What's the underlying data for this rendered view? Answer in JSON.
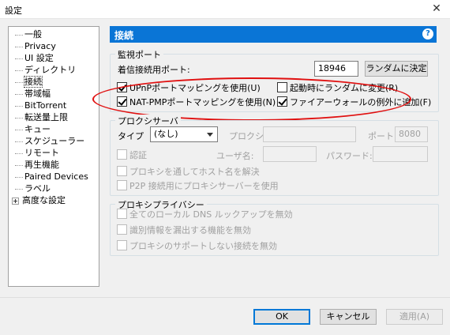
{
  "window": {
    "title": "設定",
    "close_glyph": "✕"
  },
  "tree": {
    "items": [
      {
        "label": "一般"
      },
      {
        "label": "Privacy"
      },
      {
        "label": "UI 設定"
      },
      {
        "label": "ディレクトリ"
      },
      {
        "label": "接続"
      },
      {
        "label": "帯域幅"
      },
      {
        "label": "BitTorrent"
      },
      {
        "label": "転送量上限"
      },
      {
        "label": "キュー"
      },
      {
        "label": "スケジューラー"
      },
      {
        "label": "リモート"
      },
      {
        "label": "再生機能"
      },
      {
        "label": "Paired Devices"
      },
      {
        "label": "ラベル"
      },
      {
        "label": "高度な設定"
      }
    ],
    "selected": "接続"
  },
  "header": {
    "title": "接続",
    "help_icon": "?"
  },
  "listen": {
    "group_label": "監視ポート",
    "port_label": "着信接続用ポート:",
    "port_value": "18946",
    "random_button": "ランダムに決定",
    "upnp": {
      "label": "UPnPポートマッピングを使用(U)",
      "checked": true
    },
    "random_start": {
      "label": "起動時にランダムに変更(R)",
      "checked": false
    },
    "natpmp": {
      "label": "NAT-PMPポートマッピングを使用(N)",
      "checked": true
    },
    "firewall": {
      "label": "ファイアーウォールの例外に追加(F)",
      "checked": true
    }
  },
  "proxy": {
    "group_label": "プロクシサーバ",
    "type_label": "タイプ",
    "type_value": "(なし)",
    "proxy_label": "プロクシ",
    "proxy_value": "",
    "port_label": "ポート",
    "port_value": "8080",
    "auth_label": "認証",
    "user_label": "ユーザ名:",
    "user_value": "",
    "password_label": "パスワード:",
    "password_value": "",
    "resolve_label": "プロキシを通してホスト名を解決",
    "p2p_label": "P2P 接続用にプロキシサーバーを使用"
  },
  "privacy": {
    "group_label": "プロキシプライバシー",
    "dns_label": "全てのローカル DNS ルックアップを無効",
    "leak_label": "識別情報を漏出する機能を無効",
    "unsupported_label": "プロキシのサポートしない接続を無効"
  },
  "buttons": {
    "ok": "OK",
    "cancel": "キャンセル",
    "apply": "適用(A)"
  },
  "colors": {
    "accent": "#0a75d6",
    "annotation": "#e01010"
  }
}
